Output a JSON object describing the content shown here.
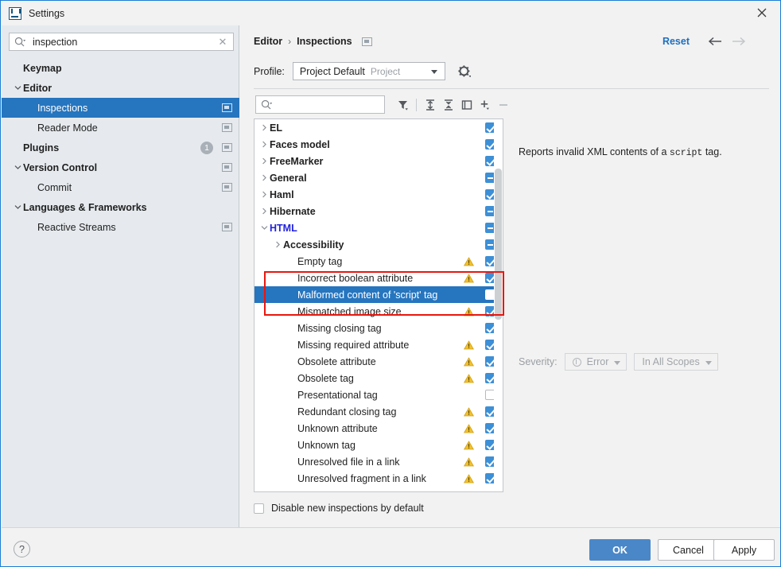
{
  "window": {
    "title": "Settings",
    "app_icon": "intellij-idea-icon",
    "close_icon": "close-icon",
    "accent_color": "#1a7fd4"
  },
  "sidebar": {
    "search": {
      "value": "inspection",
      "placeholder": "",
      "icon": "search-icon",
      "clear_icon": "clear-icon"
    },
    "items": [
      {
        "label": "Keymap",
        "level": 1,
        "bold": true,
        "caret": "",
        "selected": false,
        "modified": false,
        "badge": ""
      },
      {
        "label": "Editor",
        "level": 1,
        "bold": true,
        "caret": "expanded",
        "selected": false,
        "modified": false,
        "badge": ""
      },
      {
        "label": "Inspections",
        "level": 2,
        "bold": false,
        "caret": "",
        "selected": true,
        "modified": true,
        "badge": ""
      },
      {
        "label": "Reader Mode",
        "level": 2,
        "bold": false,
        "caret": "",
        "selected": false,
        "modified": true,
        "badge": ""
      },
      {
        "label": "Plugins",
        "level": 1,
        "bold": true,
        "caret": "",
        "selected": false,
        "modified": true,
        "badge": "1"
      },
      {
        "label": "Version Control",
        "level": 1,
        "bold": true,
        "caret": "expanded",
        "selected": false,
        "modified": true,
        "badge": ""
      },
      {
        "label": "Commit",
        "level": 2,
        "bold": false,
        "caret": "",
        "selected": false,
        "modified": true,
        "badge": ""
      },
      {
        "label": "Languages & Frameworks",
        "level": 1,
        "bold": true,
        "caret": "expanded",
        "selected": false,
        "modified": false,
        "badge": ""
      },
      {
        "label": "Reactive Streams",
        "level": 2,
        "bold": false,
        "caret": "",
        "selected": false,
        "modified": true,
        "badge": ""
      }
    ]
  },
  "header": {
    "breadcrumb_root": "Editor",
    "breadcrumb_sep": "›",
    "breadcrumb_leaf": "Inspections",
    "modified_icon": "modified-settings-icon",
    "reset_label": "Reset",
    "back_icon": "arrow-left-icon",
    "forward_icon": "arrow-right-icon",
    "reset_color": "#1c6fc1"
  },
  "profile": {
    "label": "Profile:",
    "name": "Project Default",
    "scope": "Project",
    "dropdown_icon": "chevron-down-icon",
    "gear_icon": "gear-icon"
  },
  "toolbar": {
    "search_placeholder": "",
    "search_value": "",
    "search_icon": "search-icon",
    "buttons": [
      {
        "name": "filter-icon",
        "title": "Filter Inspections"
      },
      {
        "name": "expand-all-icon",
        "title": "Expand All"
      },
      {
        "name": "collapse-all-icon",
        "title": "Collapse All"
      },
      {
        "name": "reset-to-empty-icon",
        "title": "Reset to Empty"
      },
      {
        "name": "add-icon",
        "title": "Add Scope"
      },
      {
        "name": "remove-icon",
        "title": "Remove Scope"
      }
    ]
  },
  "tree": {
    "rows": [
      {
        "label": "EL",
        "indent": 0,
        "caret": "collapsed",
        "group": true,
        "check": "on",
        "warn": false,
        "selected": false
      },
      {
        "label": "Faces model",
        "indent": 0,
        "caret": "collapsed",
        "group": true,
        "check": "on",
        "warn": false,
        "selected": false
      },
      {
        "label": "FreeMarker",
        "indent": 0,
        "caret": "collapsed",
        "group": true,
        "check": "on",
        "warn": false,
        "selected": false
      },
      {
        "label": "General",
        "indent": 0,
        "caret": "collapsed",
        "group": true,
        "check": "part",
        "warn": false,
        "selected": false
      },
      {
        "label": "Haml",
        "indent": 0,
        "caret": "collapsed",
        "group": true,
        "check": "on",
        "warn": false,
        "selected": false
      },
      {
        "label": "Hibernate",
        "indent": 0,
        "caret": "collapsed",
        "group": true,
        "check": "part",
        "warn": false,
        "selected": false
      },
      {
        "label": "HTML",
        "indent": 0,
        "caret": "expanded",
        "group": true,
        "html": true,
        "check": "part",
        "warn": false,
        "selected": false
      },
      {
        "label": "Accessibility",
        "indent": 1,
        "caret": "collapsed",
        "group": true,
        "check": "part",
        "warn": false,
        "selected": false
      },
      {
        "label": "Empty tag",
        "indent": 2,
        "caret": "",
        "group": false,
        "check": "on",
        "warn": true,
        "selected": false
      },
      {
        "label": "Incorrect boolean attribute",
        "indent": 2,
        "caret": "",
        "group": false,
        "check": "on",
        "warn": true,
        "selected": false
      },
      {
        "label": "Malformed content of 'script' tag",
        "indent": 2,
        "caret": "",
        "group": false,
        "check": "off",
        "warn": false,
        "selected": true
      },
      {
        "label": "Mismatched image size",
        "indent": 2,
        "caret": "",
        "group": false,
        "check": "on",
        "warn": true,
        "selected": false
      },
      {
        "label": "Missing closing tag",
        "indent": 2,
        "caret": "",
        "group": false,
        "check": "on",
        "warn": false,
        "selected": false
      },
      {
        "label": "Missing required attribute",
        "indent": 2,
        "caret": "",
        "group": false,
        "check": "on",
        "warn": true,
        "selected": false
      },
      {
        "label": "Obsolete attribute",
        "indent": 2,
        "caret": "",
        "group": false,
        "check": "on",
        "warn": true,
        "selected": false
      },
      {
        "label": "Obsolete tag",
        "indent": 2,
        "caret": "",
        "group": false,
        "check": "on",
        "warn": true,
        "selected": false
      },
      {
        "label": "Presentational tag",
        "indent": 2,
        "caret": "",
        "group": false,
        "check": "off",
        "warn": false,
        "selected": false
      },
      {
        "label": "Redundant closing tag",
        "indent": 2,
        "caret": "",
        "group": false,
        "check": "on",
        "warn": true,
        "selected": false
      },
      {
        "label": "Unknown attribute",
        "indent": 2,
        "caret": "",
        "group": false,
        "check": "on",
        "warn": true,
        "selected": false
      },
      {
        "label": "Unknown tag",
        "indent": 2,
        "caret": "",
        "group": false,
        "check": "on",
        "warn": true,
        "selected": false
      },
      {
        "label": "Unresolved file in a link",
        "indent": 2,
        "caret": "",
        "group": false,
        "check": "on",
        "warn": true,
        "selected": false
      },
      {
        "label": "Unresolved fragment in a link",
        "indent": 2,
        "caret": "",
        "group": false,
        "check": "on",
        "warn": true,
        "selected": false
      }
    ],
    "highlight_color": "#e8170f",
    "selection_color": "#2675bf"
  },
  "details": {
    "description_before": "Reports invalid XML contents of a ",
    "description_code": "script",
    "description_after": " tag.",
    "severity_label": "Severity:",
    "severity_value": "Error",
    "severity_icon": "error-severity-icon",
    "scope_value": "In All Scopes",
    "dropdown_icon": "chevron-down-icon"
  },
  "bottom": {
    "disable_new_label": "Disable new inspections by default",
    "disable_new_checked": false
  },
  "footer": {
    "help_label": "?",
    "ok_label": "OK",
    "cancel_label": "Cancel",
    "apply_label": "Apply",
    "ok_color": "#4a87c8"
  }
}
